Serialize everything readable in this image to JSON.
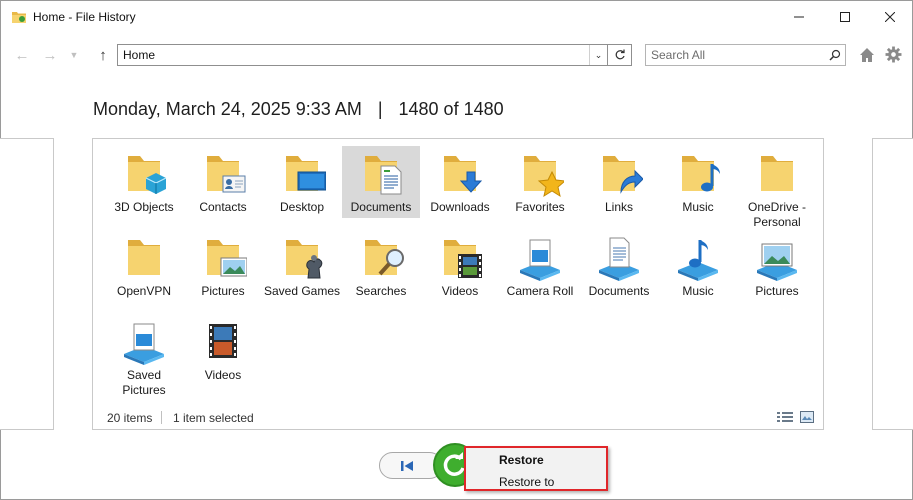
{
  "window": {
    "title": "Home - File History"
  },
  "toolbar": {
    "address": "Home",
    "search_placeholder": "Search All"
  },
  "heading": {
    "datetime": "Monday, March 24, 2025 9:33 AM",
    "separator": "|",
    "position": "1480 of 1480"
  },
  "items": [
    {
      "label": "3D Objects",
      "icon": "folder-3d-objects-icon"
    },
    {
      "label": "Contacts",
      "icon": "folder-contacts-icon"
    },
    {
      "label": "Desktop",
      "icon": "folder-desktop-icon"
    },
    {
      "label": "Documents",
      "icon": "folder-documents-icon",
      "selected": true
    },
    {
      "label": "Downloads",
      "icon": "folder-downloads-icon"
    },
    {
      "label": "Favorites",
      "icon": "folder-favorites-icon"
    },
    {
      "label": "Links",
      "icon": "folder-links-icon"
    },
    {
      "label": "Music",
      "icon": "folder-music-icon"
    },
    {
      "label": "OneDrive - Personal",
      "icon": "folder-onedrive-icon"
    },
    {
      "label": "OpenVPN",
      "icon": "folder-openvpn-icon"
    },
    {
      "label": "Pictures",
      "icon": "folder-pictures-icon"
    },
    {
      "label": "Saved Games",
      "icon": "folder-saved-games-icon"
    },
    {
      "label": "Searches",
      "icon": "folder-searches-icon"
    },
    {
      "label": "Videos",
      "icon": "folder-videos-icon"
    },
    {
      "label": "Camera Roll",
      "icon": "library-camera-roll-icon"
    },
    {
      "label": "Documents",
      "icon": "library-documents-icon"
    },
    {
      "label": "Music",
      "icon": "library-music-icon"
    },
    {
      "label": "Pictures",
      "icon": "library-pictures-icon"
    },
    {
      "label": "Saved Pictures",
      "icon": "library-saved-pictures-icon"
    },
    {
      "label": "Videos",
      "icon": "library-videos-icon"
    }
  ],
  "status": {
    "count": "20 items",
    "selected": "1 item selected"
  },
  "context_menu": {
    "restore": "Restore",
    "restore_to": "Restore to"
  },
  "colors": {
    "folder": "#f3c95a",
    "restore_green": "#3fae2e",
    "menu_highlight_border": "#e0262a",
    "selection": "#d9d9d9"
  }
}
